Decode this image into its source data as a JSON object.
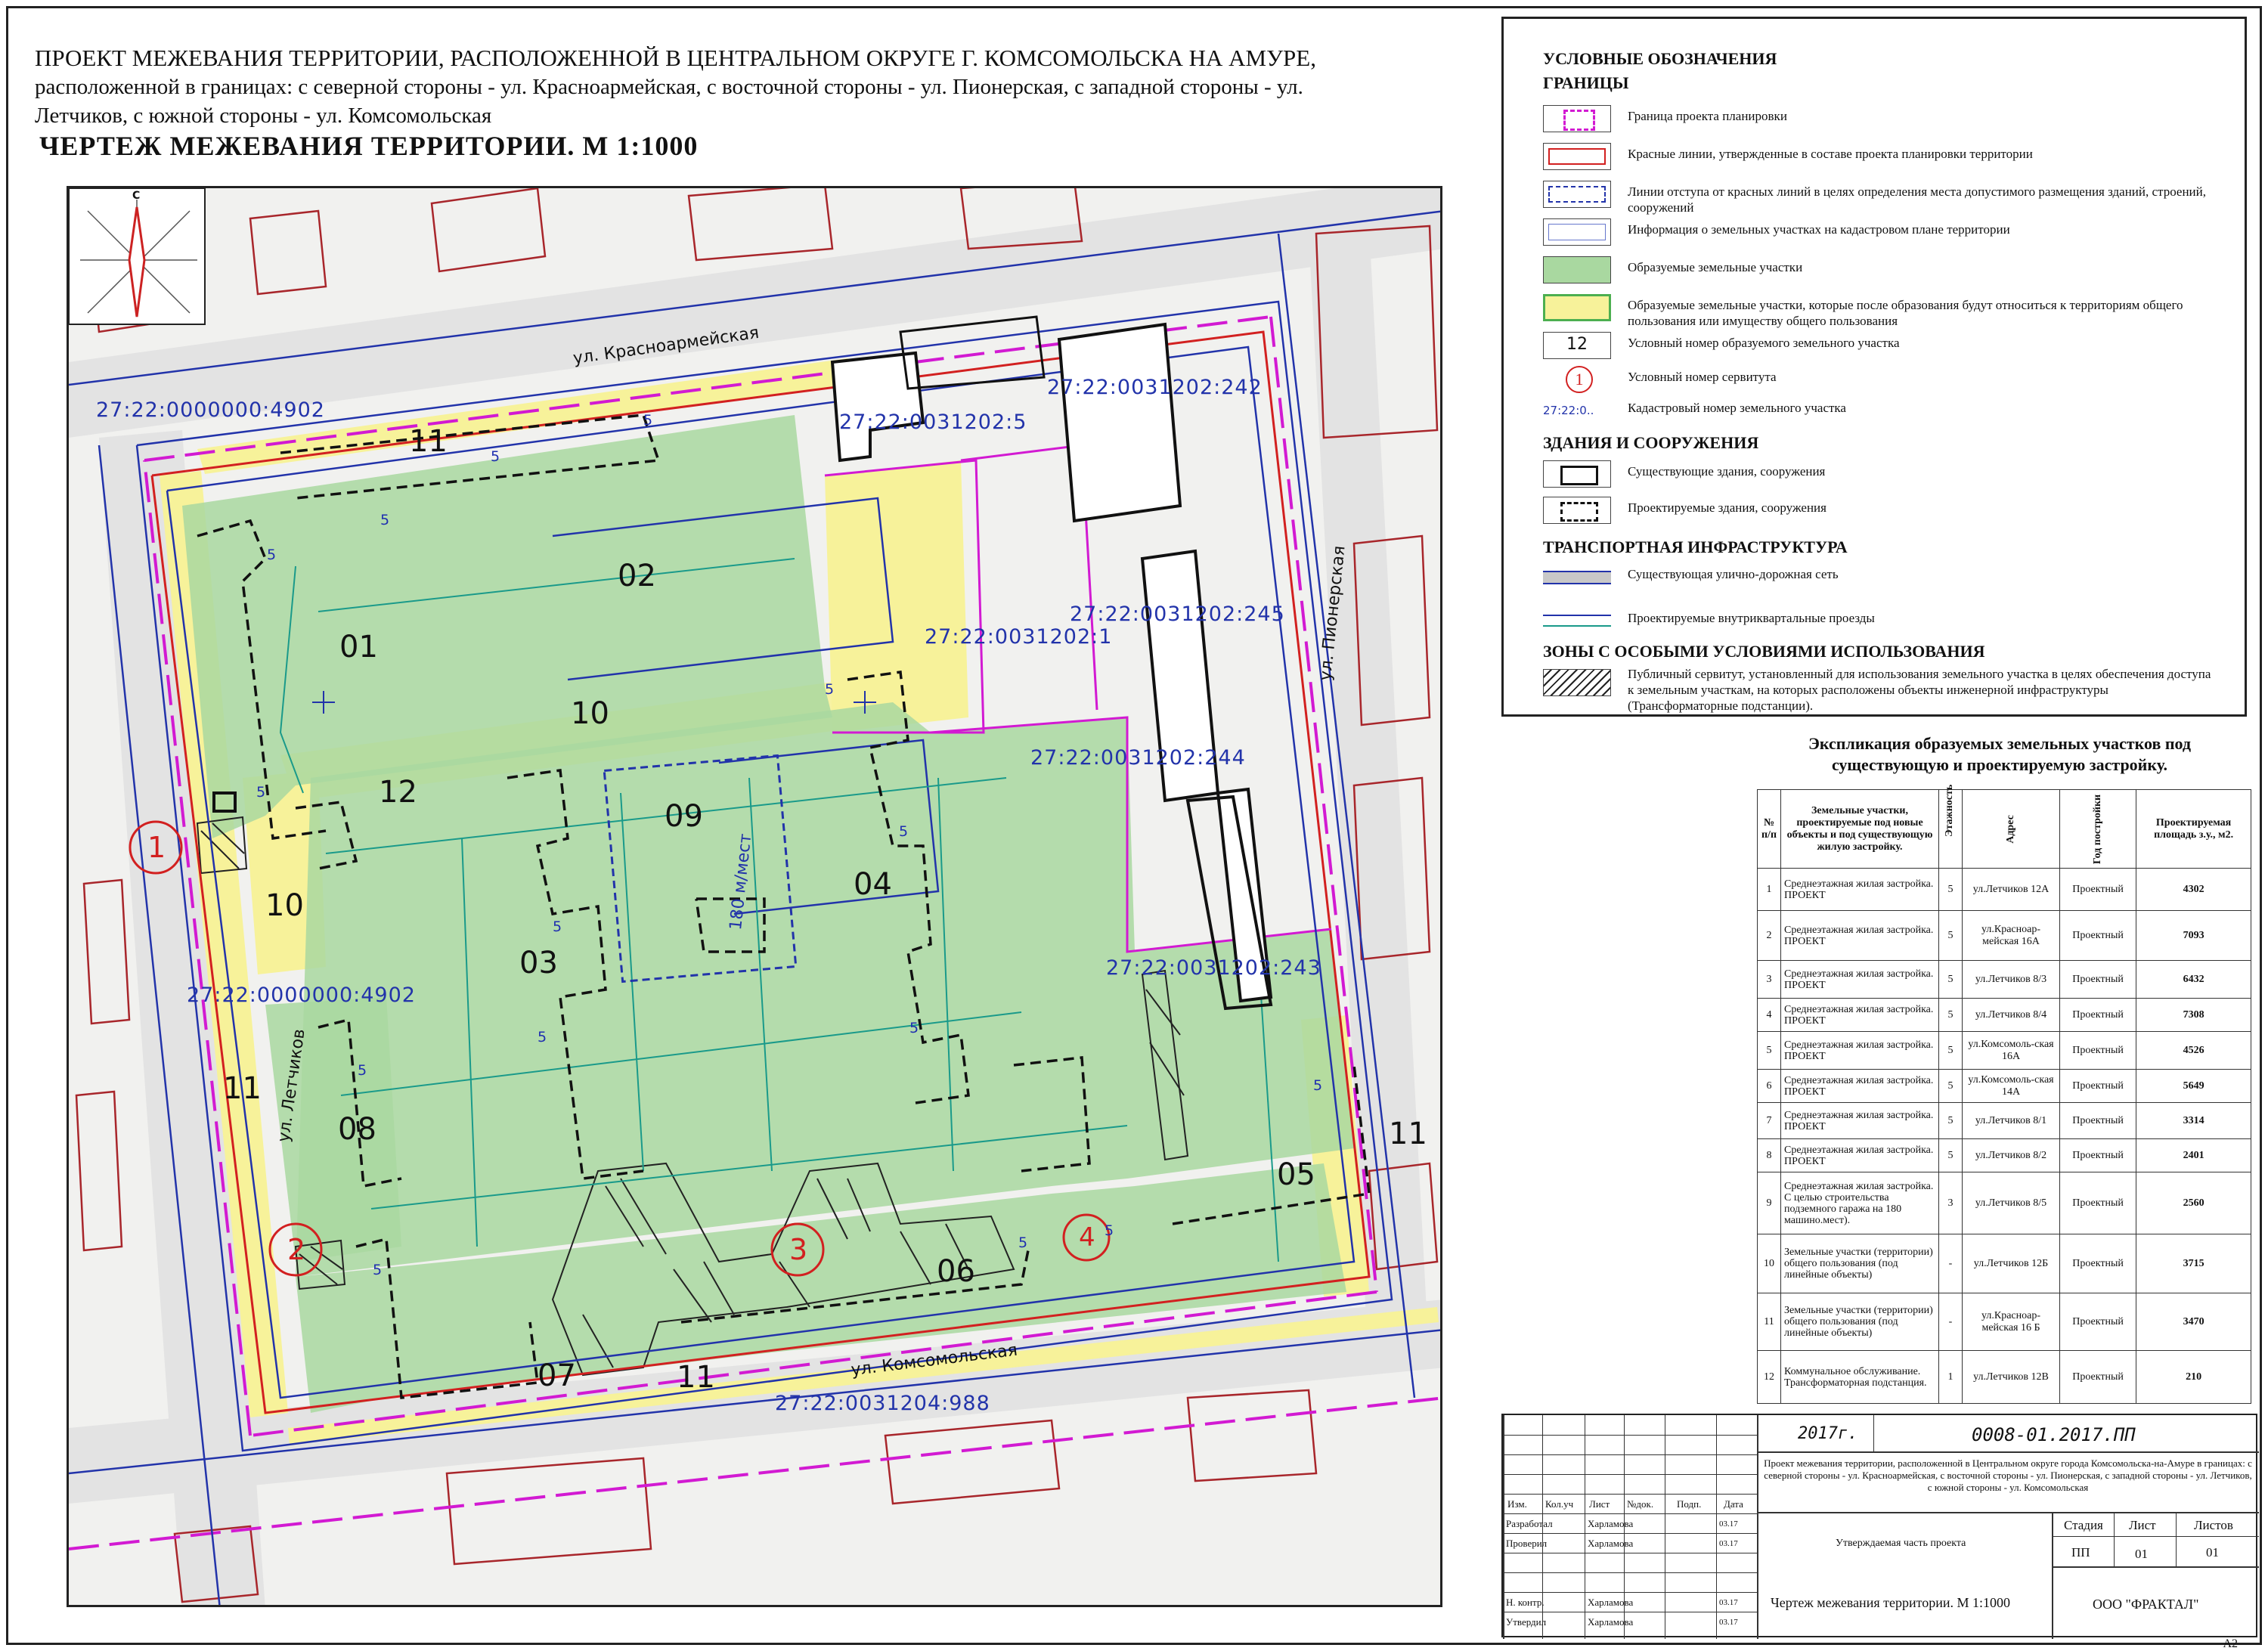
{
  "header": {
    "title_line1": "ПРОЕКТ МЕЖЕВАНИЯ ТЕРРИТОРИИ, РАСПОЛОЖЕННОЙ В ЦЕНТРАЛЬНОМ ОКРУГЕ Г. КОМСОМОЛЬСКА НА АМУРЕ,",
    "title_line2": "расположенной в границах: с северной стороны - ул. Красноармейская, с восточной стороны - ул. Пионерская, с западной стороны - ул.",
    "title_line3": "Летчиков, с южной стороны - ул. Комсомольская",
    "subtitle": "ЧЕРТЕЖ МЕЖЕВАНИЯ ТЕРРИТОРИИ. М 1:1000"
  },
  "map": {
    "compass_letter": "С",
    "streets": {
      "north": "ул. Красноармейская",
      "east": "ул. Пионерская",
      "west": "ул. Летчиков",
      "south": "ул. Комсомольская"
    },
    "cadastral_numbers": {
      "c1": "27:22:0000000:4902",
      "c2": "27:22:0031202:5",
      "c3": "27:22:0031202:242",
      "c4": "27:22:0031202:245",
      "c5": "27:22:0031202:1",
      "c6": "27:22:0031202:244",
      "c7": "27:22:0000000:4902",
      "c8": "27:22:0031202:243",
      "c9": "27:22:0031204:988"
    },
    "plots": {
      "p01": "01",
      "p02": "02",
      "p03": "03",
      "p04": "04",
      "p05": "05",
      "p06": "06",
      "p07": "07",
      "p08": "08",
      "p09": "09",
      "p10a": "10",
      "p10b": "10",
      "p11a": "11",
      "p11b": "11",
      "p11c": "11",
      "p11d": "11",
      "p12": "12"
    },
    "servitudes": {
      "s1": "1",
      "s2": "2",
      "s3": "3",
      "s4": "4"
    },
    "parking_label": "180 м/мест",
    "floors_label": "5"
  },
  "legend": {
    "title": "УСЛОВНЫЕ ОБОЗНАЧЕНИЯ",
    "sections": {
      "boundaries": "ГРАНИЦЫ",
      "buildings": "ЗДАНИЯ И СООРУЖЕНИЯ",
      "transport": "ТРАНСПОРТНАЯ ИНФРАСТРУКТУРА",
      "zones": "ЗОНЫ С ОСОБЫМИ УСЛОВИЯМИ ИСПОЛЬЗОВАНИЯ"
    },
    "items": {
      "planning_boundary": "Граница проекта планировки",
      "red_lines": "Красные линии, утвержденные в составе проекта планировки территории",
      "setback_lines": "Линии отступа от красных линий в целях определения места допустимого размещения зданий, строений, сооружений",
      "cadastral_info": "Информация о земельных участках на кадастровом плане территории",
      "formed_plots": "Образуемые земельные участки",
      "public_plots": "Образуемые земельные участки, которые после образования будут относиться к территориям общего пользования или имуществу общего пользования",
      "plot_number": "Условный номер образуемого земельного участка",
      "plot_number_sample": "12",
      "servitude_number": "Условный номер сервитута",
      "servitude_sample": "1",
      "cadastral_number": "Кадастровый номер земельного участка",
      "cadastral_sample": "27:22:0..",
      "existing_buildings": "Существующие здания, сооружения",
      "planned_buildings": "Проектируемые здания, сооружения",
      "existing_roads": "Существующая улично-дорожная сеть",
      "planned_driveways": "Проектируемые внутриквартальные проезды",
      "public_servitude": "Публичный сервитут, установленный для использования земельного участка в целях обеспечения доступа к земельным участкам, на которых расположены объекты инженерной инфраструктуры (Трансформаторные подстанции)."
    },
    "colors": {
      "magenta": "#d21ad2",
      "red": "#d22020",
      "blue": "#2233aa",
      "green": "#a9d8a0",
      "yellow": "#f7f29a"
    }
  },
  "table": {
    "title_line1": "Экспликация образуемых земельных участков под",
    "title_line2": "существующую и проектируемую застройку.",
    "headers": {
      "num": "№ п/п",
      "plots": "Земельные участки, проектируемые под новые объекты и под существующую жилую застройку.",
      "floors": "Этажность",
      "address": "Адрес",
      "year": "Год постройки",
      "area": "Проектируемая площадь з.у., м2."
    },
    "rows": [
      {
        "num": "1",
        "desc": "Среднеэтажная жилая застройка. ПРОЕКТ",
        "floors": "5",
        "address": "ул.Летчиков 12А",
        "year": "Проектный",
        "area": "4302"
      },
      {
        "num": "2",
        "desc": "Среднеэтажная жилая застройка. ПРОЕКТ",
        "floors": "5",
        "address": "ул.Красноар-мейская 16А",
        "year": "Проектный",
        "area": "7093"
      },
      {
        "num": "3",
        "desc": "Среднеэтажная жилая застройка. ПРОЕКТ",
        "floors": "5",
        "address": "ул.Летчиков 8/3",
        "year": "Проектный",
        "area": "6432"
      },
      {
        "num": "4",
        "desc": "Среднеэтажная жилая застройка. ПРОЕКТ",
        "floors": "5",
        "address": "ул.Летчиков 8/4",
        "year": "Проектный",
        "area": "7308"
      },
      {
        "num": "5",
        "desc": "Среднеэтажная жилая застройка. ПРОЕКТ",
        "floors": "5",
        "address": "ул.Комсомоль-ская 16А",
        "year": "Проектный",
        "area": "4526"
      },
      {
        "num": "6",
        "desc": "Среднеэтажная жилая застройка. ПРОЕКТ",
        "floors": "5",
        "address": "ул.Комсомоль-ская 14А",
        "year": "Проектный",
        "area": "5649"
      },
      {
        "num": "7",
        "desc": "Среднеэтажная жилая застройка. ПРОЕКТ",
        "floors": "5",
        "address": "ул.Летчиков 8/1",
        "year": "Проектный",
        "area": "3314"
      },
      {
        "num": "8",
        "desc": "Среднеэтажная жилая застройка. ПРОЕКТ",
        "floors": "5",
        "address": "ул.Летчиков 8/2",
        "year": "Проектный",
        "area": "2401"
      },
      {
        "num": "9",
        "desc": "Среднеэтажная жилая застройка. С целью строительства подземного гаража на 180 машино.мест).",
        "floors": "3",
        "address": "ул.Летчиков 8/5",
        "year": "Проектный",
        "area": "2560"
      },
      {
        "num": "10",
        "desc": "Земельные участки (территории) общего пользования (под линейные объекты)",
        "floors": "-",
        "address": "ул.Летчиков 12Б",
        "year": "Проектный",
        "area": "3715"
      },
      {
        "num": "11",
        "desc": "Земельные участки (территории) общего пользования (под линейные объекты)",
        "floors": "-",
        "address": "ул.Красноар-мейская 16 Б",
        "year": "Проектный",
        "area": "3470"
      },
      {
        "num": "12",
        "desc": "Коммунальное обслуживание. Трансформаторная подстанция.",
        "floors": "1",
        "address": "ул.Летчиков 12В",
        "year": "Проектный",
        "area": "210"
      }
    ]
  },
  "stamp": {
    "year": "2017г.",
    "code": "0008-01.2017.ПП",
    "description": "Проект межевания территории, расположенной в Центральном округе города Комсомольска-на-Амуре в границах: с северной стороны - ул. Красноармейская, с восточной стороны - ул. Пионерская, с западной стороны - ул. Летчиков, с южной стороны - ул. Комсомольская",
    "part": "Утверждаемая часть проекта",
    "sheet_title": "Чертеж межевания территории. М 1:1000",
    "org": "ООО \"ФРАКТАЛ\"",
    "cols": {
      "izm": "Изм.",
      "kol": "Кол.уч",
      "list": "Лист",
      "doc": "№док.",
      "sign": "Подп.",
      "date": "Дата"
    },
    "stage_h": "Стадия",
    "sheet_h": "Лист",
    "sheets_h": "Листов",
    "stage": "ПП",
    "sheet": "01",
    "sheets": "01",
    "roles": [
      {
        "role": "Разработал",
        "name": "Харламова",
        "date": "03.17"
      },
      {
        "role": "Проверил",
        "name": "Харламова",
        "date": "03.17"
      },
      {
        "role": "Н. контр.",
        "name": "Харламова",
        "date": "03.17"
      },
      {
        "role": "Утвердил",
        "name": "Харламова",
        "date": "03.17"
      }
    ],
    "format": "А2"
  }
}
